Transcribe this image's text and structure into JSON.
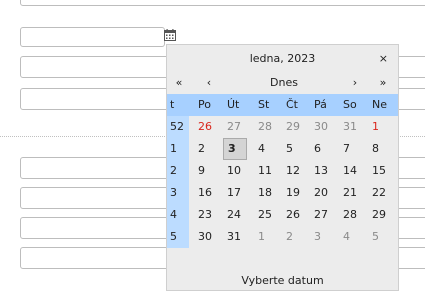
{
  "calendar": {
    "title": "ledna, 2023",
    "close": "×",
    "nav": {
      "prev_year": "«",
      "prev_month": "‹",
      "today": "Dnes",
      "next_month": "›",
      "next_year": "»"
    },
    "header": [
      "t",
      "Po",
      "Út",
      "St",
      "Čt",
      "Pá",
      "So",
      "Ne"
    ],
    "weeks": [
      {
        "wk": "52",
        "days": [
          "26",
          "27",
          "28",
          "29",
          "30",
          "31",
          "1"
        ]
      },
      {
        "wk": "1",
        "days": [
          "2",
          "3",
          "4",
          "5",
          "6",
          "7",
          "8"
        ]
      },
      {
        "wk": "2",
        "days": [
          "9",
          "10",
          "11",
          "12",
          "13",
          "14",
          "15"
        ]
      },
      {
        "wk": "3",
        "days": [
          "16",
          "17",
          "18",
          "19",
          "20",
          "21",
          "22"
        ]
      },
      {
        "wk": "4",
        "days": [
          "23",
          "24",
          "25",
          "26",
          "27",
          "28",
          "29"
        ]
      },
      {
        "wk": "5",
        "days": [
          "30",
          "31",
          "1",
          "2",
          "3",
          "4",
          "5"
        ]
      }
    ],
    "footer": "Vyberte datum",
    "colors": {
      "header_bg": "#a7d0ff",
      "week_bg": "#bcdcff",
      "body_bg": "#ececec",
      "holiday": "#d9261c"
    }
  },
  "icons": {
    "calendar": "calendar-icon"
  }
}
